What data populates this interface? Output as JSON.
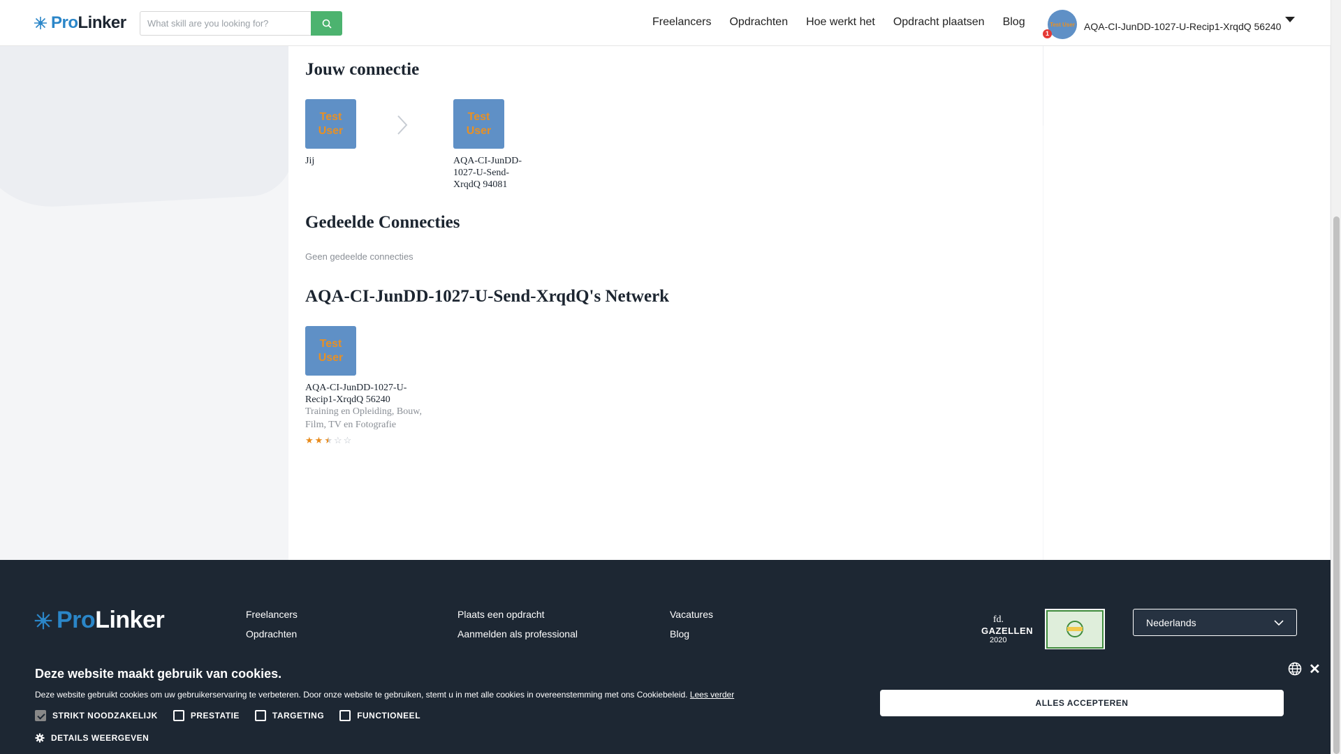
{
  "header": {
    "logo_pro": "Pro",
    "logo_linker": "Linker",
    "search_placeholder": "What skill are you looking for?",
    "nav": [
      "Freelancers",
      "Opdrachten",
      "Hoe werkt het",
      "Opdracht plaatsen",
      "Blog"
    ],
    "avatar_text": "Test User",
    "notification_count": "1",
    "user_name": "AQA-CI-JunDD-1027-U-Recip1-XrqdQ 56240"
  },
  "connection": {
    "title": "Jouw connectie",
    "you": {
      "avatar_line1": "Test",
      "avatar_line2": "User",
      "label": "Jij"
    },
    "other": {
      "avatar_line1": "Test",
      "avatar_line2": "User",
      "name_line1": "AQA-CI-JunDD-",
      "name_line2": "1027-U-Send-",
      "name_line3": "XrqdQ 94081"
    }
  },
  "shared": {
    "title": "Gedeelde Connecties",
    "empty": "Geen gedeelde connecties"
  },
  "network": {
    "title": "AQA-CI-JunDD-1027-U-Send-XrqdQ's Netwerk",
    "member": {
      "avatar_line1": "Test",
      "avatar_line2": "User",
      "name_line1": "AQA-CI-JunDD-1027-U-",
      "name_line2": "Recip1-XrqdQ 56240",
      "skills_line1": "Training en Opleiding, Bouw,",
      "skills_line2": "Film, TV en Fotografie",
      "rating": 2.5,
      "rating_max": 5
    }
  },
  "footer": {
    "logo_pro": "Pro",
    "logo_linker": "Linker",
    "col1": [
      "Freelancers",
      "Opdrachten"
    ],
    "col2": [
      "Plaats een opdracht",
      "Aanmelden als professional"
    ],
    "col3": [
      "Vacatures",
      "Blog"
    ],
    "badge_fd_line1": "fd.",
    "badge_fd_line2": "GAZELLEN",
    "badge_fd_year": "2020",
    "language": "Nederlands"
  },
  "cookie": {
    "title": "Deze website maakt gebruik van cookies.",
    "text": "Deze website gebruikt cookies om uw gebruikerservaring te verbeteren. Door onze website te gebruiken, stemt u in met alle cookies in overeenstemming met ons Cookiebeleid.",
    "read_more": "Lees verder",
    "options": [
      {
        "label": "STRIKT NOODZAKELIJK",
        "checked": true
      },
      {
        "label": "PRESTATIE",
        "checked": false
      },
      {
        "label": "TARGETING",
        "checked": false
      },
      {
        "label": "FUNCTIONEEL",
        "checked": false
      }
    ],
    "details": "DETAILS WEERGEVEN",
    "accept": "ALLES ACCEPTEREN"
  },
  "colors": {
    "brand_blue": "#2b86c8",
    "accent_green": "#4cb36f",
    "avatar_bg": "#5f90c6",
    "avatar_text": "#e89024",
    "footer_bg": "#1d2733",
    "star": "#e88a1a"
  }
}
